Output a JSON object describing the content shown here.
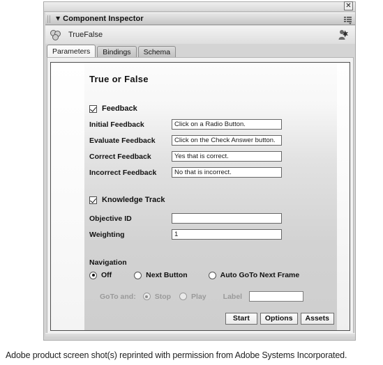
{
  "window": {
    "close_icon": "close-icon",
    "panel_title": "Component Inspector",
    "disclosure": "▼",
    "menu_icon": "panel-menu-icon"
  },
  "instance": {
    "icon": "component-icon",
    "name": "TrueFalse",
    "right_icon": "person-search-icon"
  },
  "tabs": [
    {
      "label": "Parameters",
      "active": true
    },
    {
      "label": "Bindings",
      "active": false
    },
    {
      "label": "Schema",
      "active": false
    }
  ],
  "form": {
    "heading": "True or False",
    "feedback": {
      "checkbox_label": "Feedback",
      "checked": true,
      "fields": [
        {
          "label": "Initial Feedback",
          "value": "Click on a Radio Button."
        },
        {
          "label": "Evaluate Feedback",
          "value": "Click on the Check Answer button."
        },
        {
          "label": "Correct Feedback",
          "value": "Yes that is correct."
        },
        {
          "label": "Incorrect Feedback",
          "value": "No that is incorrect."
        }
      ]
    },
    "knowledge_track": {
      "checkbox_label": "Knowledge Track",
      "checked": true,
      "fields": [
        {
          "label": "Objective ID",
          "value": ""
        },
        {
          "label": "Weighting",
          "value": "1"
        }
      ]
    },
    "navigation": {
      "title": "Navigation",
      "options": [
        {
          "label": "Off",
          "selected": true
        },
        {
          "label": "Next Button",
          "selected": false
        },
        {
          "label": "Auto GoTo Next Frame",
          "selected": false
        }
      ],
      "goto_row": {
        "prefix_label": "GoTo and:",
        "options": [
          {
            "label": "Stop",
            "selected": true
          },
          {
            "label": "Play",
            "selected": false
          }
        ],
        "label_caption": "Label",
        "label_value": ""
      }
    },
    "buttons": [
      {
        "label": "Start"
      },
      {
        "label": "Options"
      },
      {
        "label": "Assets"
      }
    ]
  },
  "caption": "Adobe product screen shot(s) reprinted with permission from Adobe Systems Incorporated."
}
